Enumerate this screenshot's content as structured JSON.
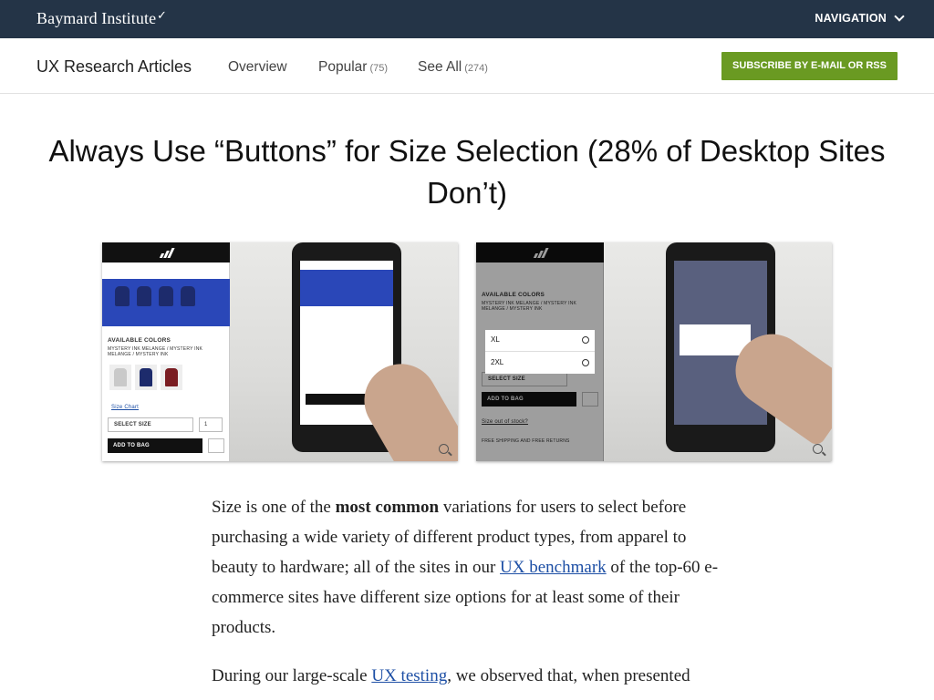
{
  "topbar": {
    "logo": "Baymard Institute",
    "navigation_label": "NAVIGATION"
  },
  "subnav": {
    "title": "UX Research Articles",
    "links": [
      {
        "label": "Overview",
        "count": ""
      },
      {
        "label": "Popular",
        "count": "(75)"
      },
      {
        "label": "See All",
        "count": "(274)"
      }
    ],
    "subscribe_label": "SUBSCRIBE BY E-MAIL OR RSS"
  },
  "article": {
    "title": "Always Use “Buttons” for Size Selection (28% of Desktop Sites Don’t)",
    "image_a": {
      "available_colors": "AVAILABLE COLORS",
      "color_names": "MYSTERY INK MELANGE / MYSTERY INK MELANGE / MYSTERY INK",
      "size_chart": "Size Chart",
      "select_size": "SELECT SIZE",
      "quantity": "1",
      "add_to_bag": "ADD TO BAG"
    },
    "image_b": {
      "available_colors": "AVAILABLE COLORS",
      "color_names": "MYSTERY INK MELANGE / MYSTERY INK MELANGE / MYSTERY INK",
      "size_options": [
        "XL",
        "2XL"
      ],
      "select_size": "SELECT SIZE",
      "add_to_bag": "ADD TO BAG",
      "out_of_stock": "Size out of stock?",
      "shipping": "FREE SHIPPING AND FREE RETURNS"
    },
    "p1": {
      "a": "Size is one of the ",
      "bold": "most common",
      "b": " variations for users to select before purchasing a wide variety of different product types, from apparel to beauty to hardware; all of the sites in our ",
      "link": "UX benchmark",
      "c": " of the top-60 e-commerce sites have different size options for at least some of their products."
    },
    "p2": {
      "a": "During our large-scale ",
      "link": "UX testing",
      "b": ", we observed that, when presented"
    }
  }
}
